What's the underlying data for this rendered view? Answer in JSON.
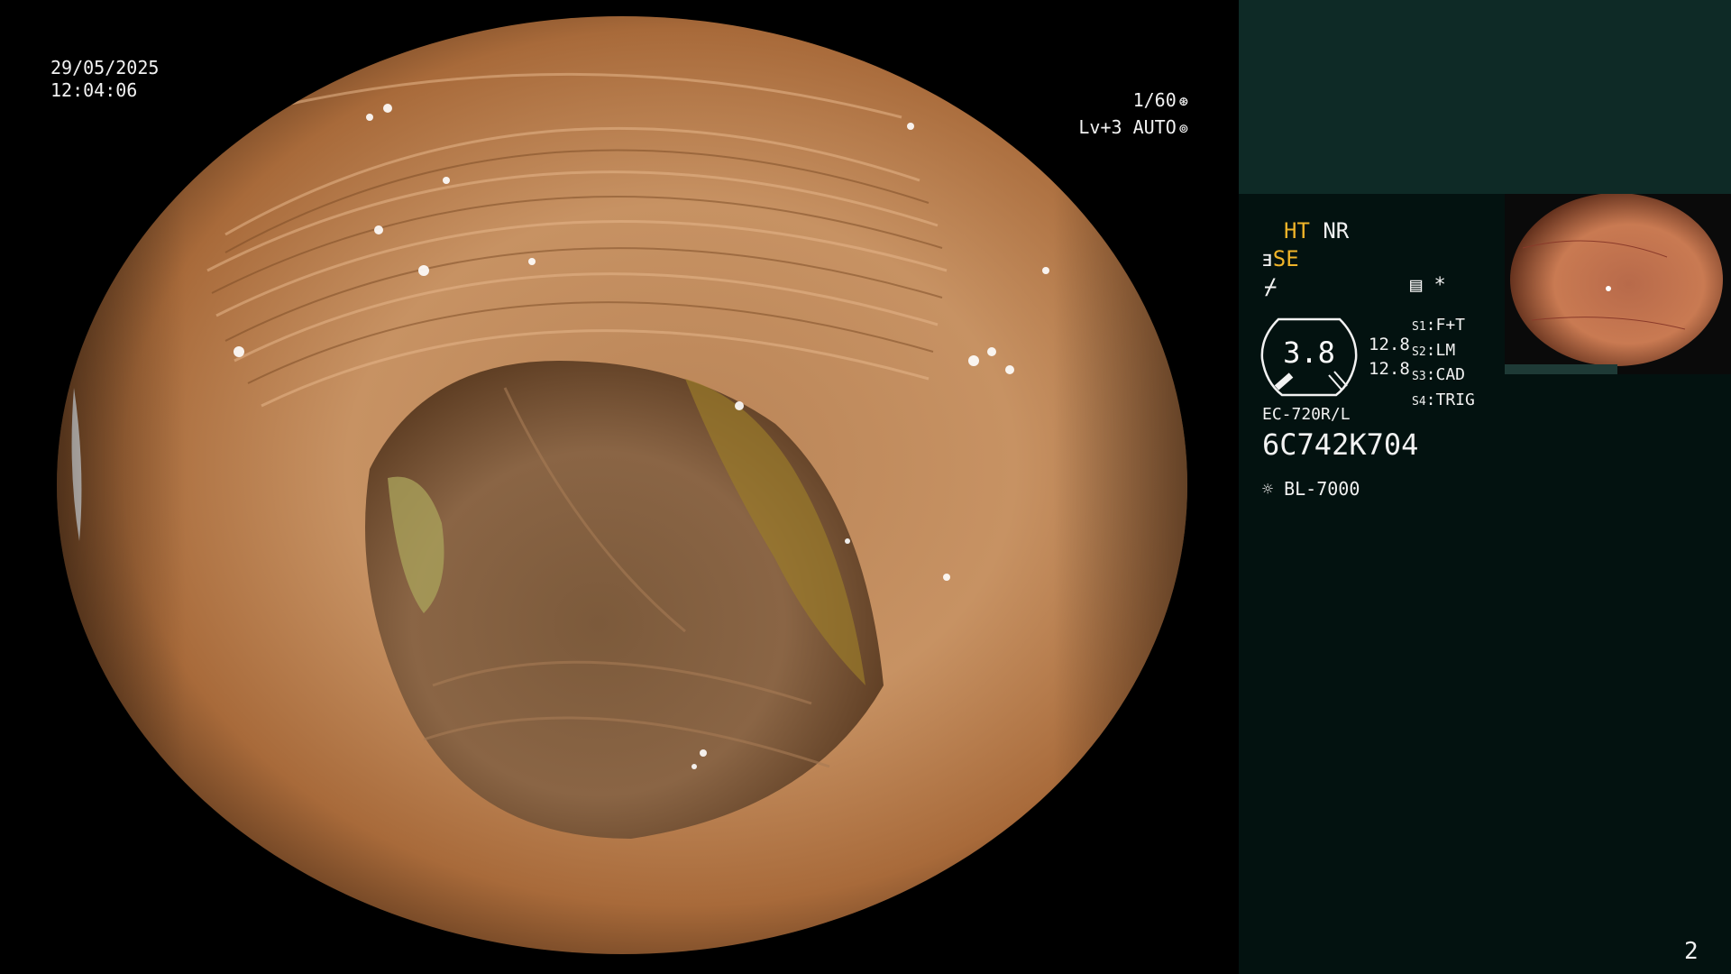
{
  "osd": {
    "date": "29/05/2025",
    "time": "12:04:06",
    "shutter": "1/60",
    "shutter_icon": "aperture-icon",
    "iris_level": "Lv+3 AUTO",
    "iris_icon": "iris-icon"
  },
  "panel": {
    "ht": "HT",
    "nr": "NR",
    "se": "SE",
    "se_icon": "enhance-icon",
    "third_icon": "freeze-icon",
    "third_icon_glyph": "⌿",
    "mode_icon": "image-mode-icon",
    "star": "*",
    "gauge": {
      "value": "3.8",
      "upper": "12.8",
      "lower": "12.8"
    },
    "slots": [
      {
        "key": "S1",
        "value": "F+T"
      },
      {
        "key": "S2",
        "value": "LM"
      },
      {
        "key": "S3",
        "value": "CAD"
      },
      {
        "key": "S4",
        "value": "TRIG"
      }
    ],
    "scope_model": "EC-720R/L",
    "scope_serial": "6C742K704",
    "light_icon": "light-source-icon",
    "light_source": "BL-7000",
    "page_number": "2"
  },
  "colors": {
    "accent": "#f0b429",
    "panel_bg": "#031210",
    "panel_top": "#0e2a26"
  }
}
